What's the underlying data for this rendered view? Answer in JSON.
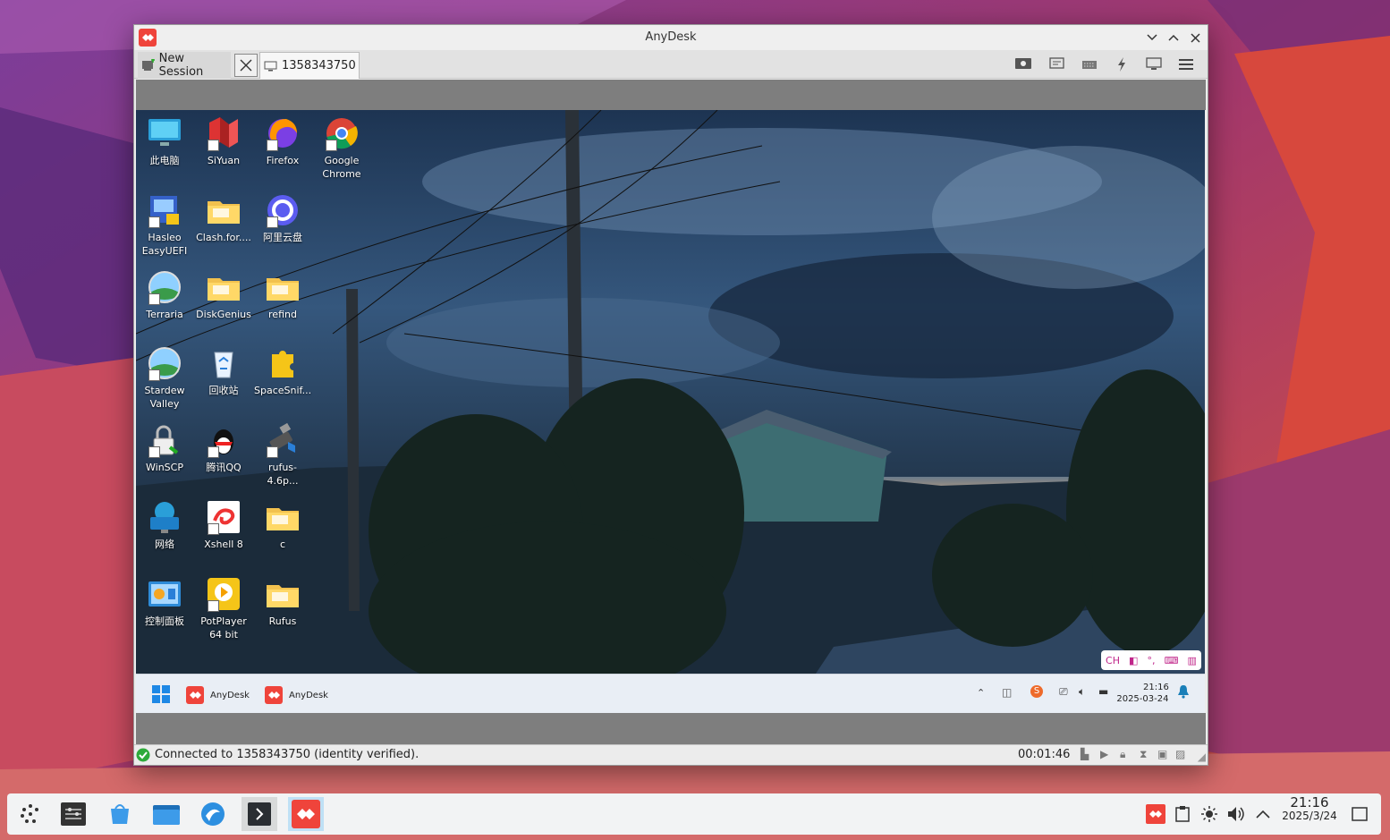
{
  "window": {
    "title": "AnyDesk"
  },
  "tabs": {
    "new_session": "New Session",
    "session_id": "1358343750"
  },
  "remote_desktop": {
    "icons": [
      {
        "label": "此电脑",
        "kind": "monitor"
      },
      {
        "label": "SiYuan",
        "kind": "siyuan"
      },
      {
        "label": "Firefox",
        "kind": "firefox"
      },
      {
        "label": "Google Chrome",
        "kind": "chrome"
      },
      {
        "label": "Hasleo EasyUEFI",
        "kind": "uefi"
      },
      {
        "label": "Clash.for....",
        "kind": "folder"
      },
      {
        "label": "阿里云盘",
        "kind": "aliyun"
      },
      {
        "label": "Terraria",
        "kind": "globe"
      },
      {
        "label": "DiskGenius",
        "kind": "folder"
      },
      {
        "label": "refind",
        "kind": "folder"
      },
      {
        "label": "Stardew Valley",
        "kind": "globe"
      },
      {
        "label": "回收站",
        "kind": "recycle"
      },
      {
        "label": "SpaceSnif...",
        "kind": "puzzle"
      },
      {
        "label": "WinSCP",
        "kind": "lock"
      },
      {
        "label": "腾讯QQ",
        "kind": "qq"
      },
      {
        "label": "rufus-4.6p...",
        "kind": "usb"
      },
      {
        "label": "网络",
        "kind": "network"
      },
      {
        "label": "Xshell 8",
        "kind": "xshell"
      },
      {
        "label": "c",
        "kind": "folder"
      },
      {
        "label": "控制面板",
        "kind": "control"
      },
      {
        "label": "PotPlayer 64 bit",
        "kind": "potplayer"
      },
      {
        "label": "Rufus",
        "kind": "folder"
      }
    ],
    "ime_indicator": "CH",
    "taskbar": {
      "apps": [
        "AnyDesk",
        "AnyDesk"
      ],
      "time": "21:16",
      "date": "2025-03-24"
    }
  },
  "status": {
    "text": "Connected to 1358343750 (identity verified).",
    "timer": "00:01:46"
  },
  "host_panel": {
    "time": "21:16",
    "date": "2025/3/24"
  },
  "colors": {
    "anydesk_red": "#ef443b",
    "status_ok": "#2eaa3a",
    "gray_band": "#7e7e7e"
  }
}
